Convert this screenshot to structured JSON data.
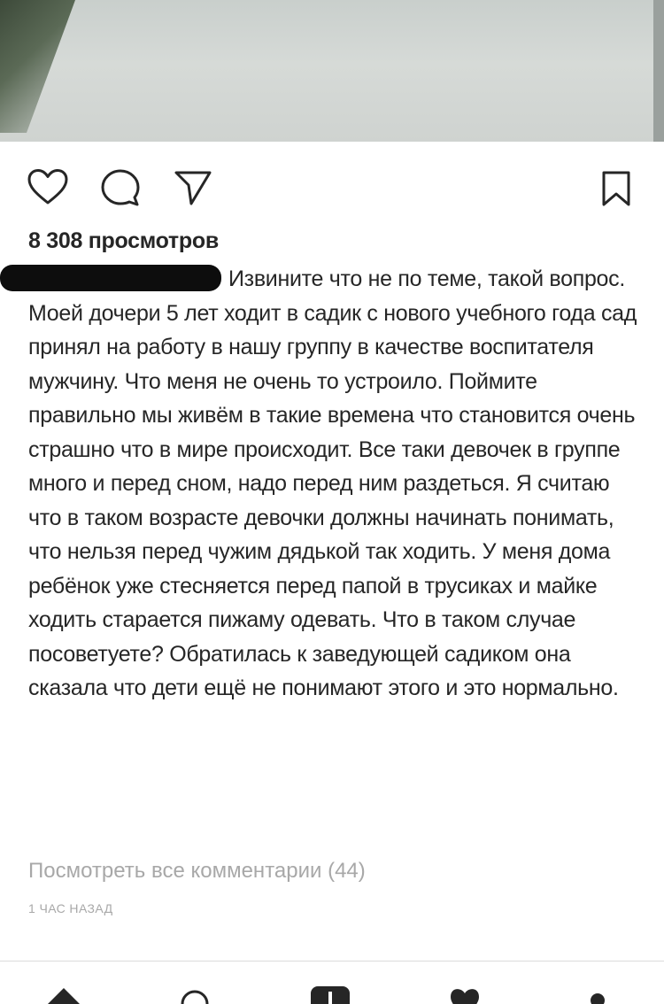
{
  "post": {
    "views": "8 308 просмотров",
    "caption": "Извините что не по теме, такой вопрос.  Моей дочери 5 лет ходит в садик с нового учебного года сад принял на работу в нашу группу в качестве воспитателя мужчину. Что меня не очень то устроило. Поймите правильно мы живём в такие времена что становится очень страшно что в мире происходит.  Все таки девочек в группе много и перед сном, надо перед ним раздеться.  Я считаю что в таком возрасте девочки должны начинать понимать,  что нельзя перед чужим дядькой так ходить. У меня дома ребёнок уже стесняется перед папой в трусиках и майке ходить старается пижаму одевать. Что в таком случае посоветуете? Обратилась к заведующей садиком она сказала что дети ещё не понимают этого и это нормально.",
    "view_all_comments": "Посмотреть все комментарии (44)",
    "timestamp": "1 ЧАС НАЗАД"
  },
  "icons": {
    "like": "heart-icon",
    "comment": "comment-icon",
    "share": "send-icon",
    "save": "bookmark-icon"
  },
  "tabbar": [
    "home-icon",
    "search-icon",
    "add-icon",
    "activity-icon",
    "profile-icon"
  ]
}
